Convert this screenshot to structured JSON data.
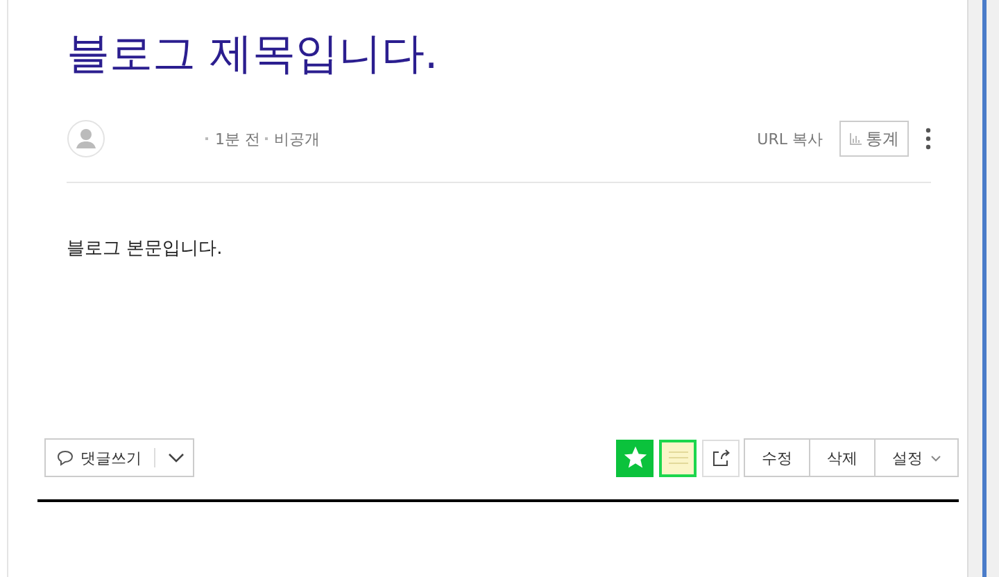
{
  "post": {
    "title": "블로그 제목입니다.",
    "meta": [
      "1분 전",
      "비공개"
    ],
    "url_copy": "URL 복사",
    "stats": "통계",
    "body": "블로그 본문입니다."
  },
  "footer": {
    "comment": "댓글쓰기",
    "actions": [
      {
        "label": "수정",
        "caret": false
      },
      {
        "label": "삭제",
        "caret": false
      },
      {
        "label": "설정",
        "caret": true
      }
    ]
  }
}
